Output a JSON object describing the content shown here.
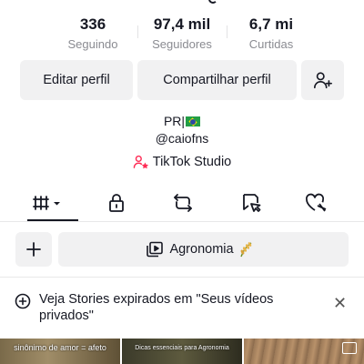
{
  "stats": [
    {
      "value": "336",
      "label": "Seguindo"
    },
    {
      "value": "97,4 mil",
      "label": "Seguidores"
    },
    {
      "value": "6,7 mi",
      "label": "Curtidas"
    }
  ],
  "buttons": {
    "edit_profile": "Editar perfil",
    "share_profile": "Compartilhar perfil"
  },
  "profile": {
    "name": "PR|",
    "handle": "@caiofns",
    "studio_link": "TikTok Studio"
  },
  "tabs": [
    {
      "icon": "grid-icon",
      "active": true
    },
    {
      "icon": "lock-icon",
      "active": false
    },
    {
      "icon": "repost-icon",
      "active": false
    },
    {
      "icon": "tagged-icon",
      "active": false
    },
    {
      "icon": "liked-icon",
      "active": false
    }
  ],
  "playlist": {
    "label": "Agronomia"
  },
  "banner": {
    "text": "Veja Stories expirados em \"Seus vídeos privados\""
  },
  "thumbnails": [
    {
      "caption": "sinônimo de amor = afeto"
    },
    {
      "caption": "Dicas essenciais para Agronomia"
    },
    {
      "caption": ""
    }
  ],
  "colors": {
    "accent": "#fe2c55",
    "text": "#161823",
    "muted": "#8a8b91",
    "button_bg": "#f1f1f2"
  }
}
